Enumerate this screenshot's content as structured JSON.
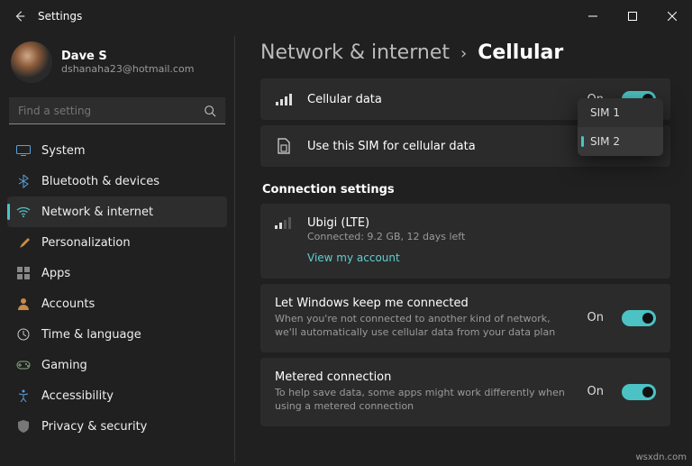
{
  "window": {
    "title": "Settings"
  },
  "profile": {
    "name": "Dave S",
    "email": "dshanaha23@hotmail.com"
  },
  "search": {
    "placeholder": "Find a setting"
  },
  "nav": [
    {
      "label": "System"
    },
    {
      "label": "Bluetooth & devices"
    },
    {
      "label": "Network & internet"
    },
    {
      "label": "Personalization"
    },
    {
      "label": "Apps"
    },
    {
      "label": "Accounts"
    },
    {
      "label": "Time & language"
    },
    {
      "label": "Gaming"
    },
    {
      "label": "Accessibility"
    },
    {
      "label": "Privacy & security"
    }
  ],
  "breadcrumb": {
    "parent": "Network & internet",
    "sep": "›",
    "current": "Cellular"
  },
  "cellular_data": {
    "label": "Cellular data",
    "state": "On"
  },
  "sim_select": {
    "label": "Use this SIM for cellular data",
    "options": [
      "SIM 1",
      "SIM 2"
    ],
    "selected": "SIM 2"
  },
  "connection_settings": {
    "title": "Connection settings",
    "operator": "Ubigi (LTE)",
    "status": "Connected: 9.2 GB, 12 days left",
    "link": "View my account"
  },
  "keep_connected": {
    "title": "Let Windows keep me connected",
    "desc": "When you're not connected to another kind of network, we'll automatically use cellular data from your data plan",
    "state": "On"
  },
  "metered": {
    "title": "Metered connection",
    "desc": "To help save data, some apps might work differently when using a metered connection",
    "state": "On"
  },
  "watermark": "wsxdn.com"
}
